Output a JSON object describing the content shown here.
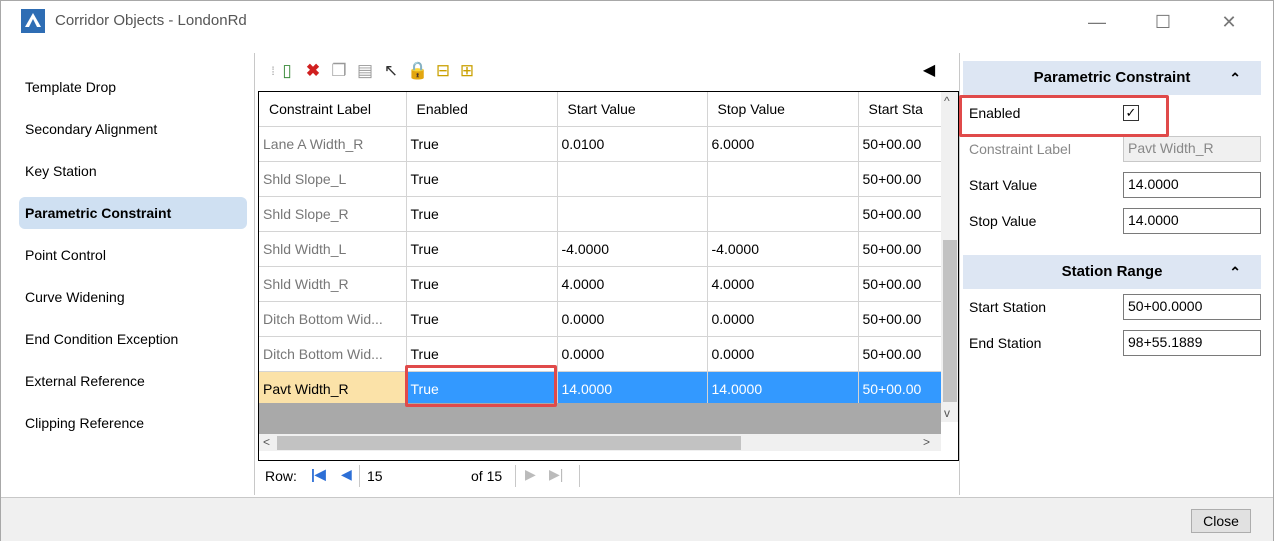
{
  "window": {
    "title": "Corridor Objects - LondonRd"
  },
  "nav": {
    "items": [
      {
        "label": "Template Drop"
      },
      {
        "label": "Secondary Alignment"
      },
      {
        "label": "Key Station"
      },
      {
        "label": "Parametric Constraint"
      },
      {
        "label": "Point Control"
      },
      {
        "label": "Curve Widening"
      },
      {
        "label": "End Condition Exception"
      },
      {
        "label": "External Reference"
      },
      {
        "label": "Clipping Reference"
      }
    ],
    "active": "Parametric Constraint"
  },
  "grid": {
    "columns": [
      "Constraint Label",
      "Enabled",
      "Start Value",
      "Stop Value",
      "Start Sta"
    ],
    "rows": [
      [
        "Lane A Width_R",
        "True",
        "0.0100",
        "6.0000",
        "50+00.00"
      ],
      [
        "Shld Slope_L",
        "True",
        "",
        "",
        "50+00.00"
      ],
      [
        "Shld Slope_R",
        "True",
        "",
        "",
        "50+00.00"
      ],
      [
        "Shld Width_L",
        "True",
        "-4.0000",
        "-4.0000",
        "50+00.00"
      ],
      [
        "Shld Width_R",
        "True",
        "4.0000",
        "4.0000",
        "50+00.00"
      ],
      [
        "Ditch Bottom Wid...",
        "True",
        "0.0000",
        "0.0000",
        "50+00.00"
      ],
      [
        "Ditch Bottom Wid...",
        "True",
        "0.0000",
        "0.0000",
        "50+00.00"
      ],
      [
        "Pavt Width_R",
        "True",
        "14.0000",
        "14.0000",
        "50+00.00"
      ]
    ],
    "selected_row": 7
  },
  "rowbar": {
    "label": "Row:",
    "current": "15",
    "of": "of 15"
  },
  "panel_constraint": {
    "title": "Parametric Constraint",
    "enabled_label": "Enabled",
    "enabled_checked": true,
    "constraint_label": "Constraint Label",
    "constraint_value": "Pavt Width_R",
    "start_label": "Start Value",
    "start_value": "14.0000",
    "stop_label": "Stop Value",
    "stop_value": "14.0000"
  },
  "panel_station": {
    "title": "Station Range",
    "start_label": "Start Station",
    "start_value": "50+00.0000",
    "end_label": "End Station",
    "end_value": "98+55.1889"
  },
  "footer": {
    "close_label": "Close"
  },
  "colors": {
    "selection": "#3399ff",
    "highlight": "#e04a4a",
    "panel_header": "#dde6f3"
  }
}
